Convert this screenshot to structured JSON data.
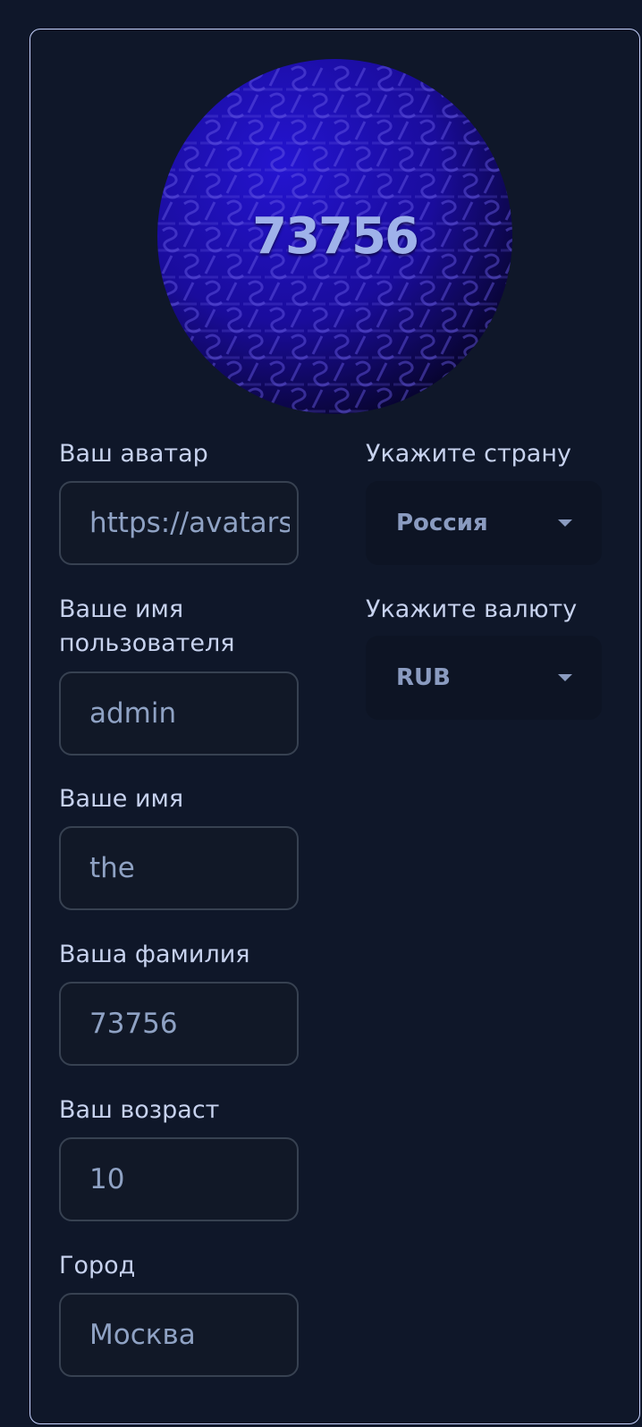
{
  "avatar": {
    "text": "73756",
    "gradient_start": "#1e10c4",
    "gradient_end": "#07052a",
    "pattern_glyph": "S/"
  },
  "fields": {
    "avatar_url": {
      "label": "Ваш аватар",
      "value": "https://avatars.example"
    },
    "username": {
      "label": "Ваше имя пользователя",
      "value": "admin"
    },
    "first_name": {
      "label": "Ваше имя",
      "value": "the"
    },
    "last_name": {
      "label": "Ваша фамилия",
      "value": "73756"
    },
    "age": {
      "label": "Ваш возраст",
      "value": "10"
    },
    "city": {
      "label": "Город",
      "value": "Москва"
    }
  },
  "selects": {
    "country": {
      "label": "Укажите страну",
      "value": "Россия"
    },
    "currency": {
      "label": "Укажите валюту",
      "value": "RUB"
    }
  },
  "colors": {
    "background": "#0f172a",
    "card_border": "#c7d2fe",
    "label": "#c7d2ee",
    "input_text": "#8fa2c4"
  }
}
